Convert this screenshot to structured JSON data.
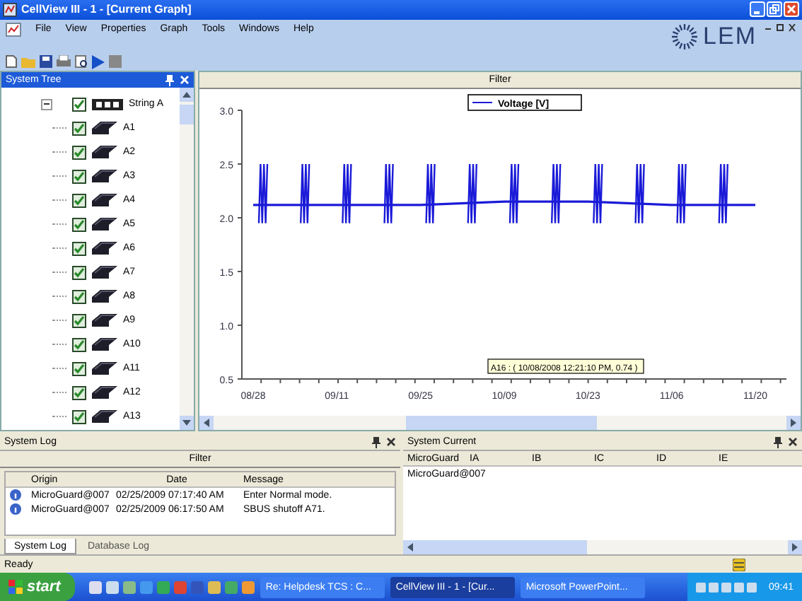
{
  "window": {
    "title": "CellView III - 1 - [Current Graph]"
  },
  "menu": [
    "File",
    "View",
    "Properties",
    "Graph",
    "Tools",
    "Windows",
    "Help"
  ],
  "logo": "LEM",
  "system_tree": {
    "title": "System Tree",
    "root": {
      "label": "String A",
      "checked": true,
      "expanded": true,
      "children": [
        {
          "label": "A1",
          "checked": true
        },
        {
          "label": "A2",
          "checked": true
        },
        {
          "label": "A3",
          "checked": true
        },
        {
          "label": "A4",
          "checked": true
        },
        {
          "label": "A5",
          "checked": true
        },
        {
          "label": "A6",
          "checked": true
        },
        {
          "label": "A7",
          "checked": true
        },
        {
          "label": "A8",
          "checked": true
        },
        {
          "label": "A9",
          "checked": true
        },
        {
          "label": "A10",
          "checked": true
        },
        {
          "label": "A11",
          "checked": true
        },
        {
          "label": "A12",
          "checked": true
        },
        {
          "label": "A13",
          "checked": true
        }
      ]
    }
  },
  "graph": {
    "filter": "Filter",
    "chart_data": {
      "type": "line",
      "categories": [
        "08/28",
        "09/11",
        "09/25",
        "10/09",
        "10/23",
        "11/06",
        "11/20"
      ],
      "ylim": [
        0.5,
        3.0
      ],
      "yticks": [
        {
          "value": 0.5,
          "label": "0.5"
        },
        {
          "value": 1.0,
          "label": "1.0"
        },
        {
          "value": 1.5,
          "label": "1.5"
        },
        {
          "value": 2.0,
          "label": "2.0"
        },
        {
          "value": 2.5,
          "label": "2.5"
        },
        {
          "value": 3.0,
          "label": "3.0"
        }
      ],
      "series": [
        {
          "name": "Voltage [V]",
          "color": "#1a1ad8",
          "values": [
            2.12,
            2.12,
            2.12,
            2.15,
            2.15,
            2.12,
            2.12
          ]
        }
      ],
      "annotations": [
        "A16 : ( 10/08/2008 12:21:10 PM, 0.74 )"
      ]
    }
  },
  "system_log": {
    "title": "System Log",
    "filter": "Filter",
    "columns": [
      "Origin",
      "Date",
      "Message"
    ],
    "rows": [
      [
        "MicroGuard@007",
        "02/25/2009 07:17:40 AM",
        "Enter Normal mode."
      ],
      [
        "MicroGuard@007",
        "02/25/2009 06:17:50 AM",
        "SBUS shutoff A71."
      ]
    ],
    "tabs": [
      {
        "label": "System Log",
        "selected": true
      },
      {
        "label": "Database Log",
        "selected": false
      }
    ]
  },
  "system_current": {
    "title": "System Current",
    "columns": [
      "MicroGuard",
      "IA",
      "IB",
      "IC",
      "ID",
      "IE"
    ],
    "rows": [
      [
        "MicroGuard@007"
      ]
    ]
  },
  "status_bar": "Ready",
  "taskbar": {
    "start": "start",
    "tasks": [
      {
        "label": "Re: Helpdesk TCS : C...",
        "selected": false
      },
      {
        "label": "CellView III - 1 - [Cur...",
        "selected": true
      },
      {
        "label": "Microsoft PowerPoint...",
        "selected": false
      }
    ],
    "clock": "09:41"
  }
}
